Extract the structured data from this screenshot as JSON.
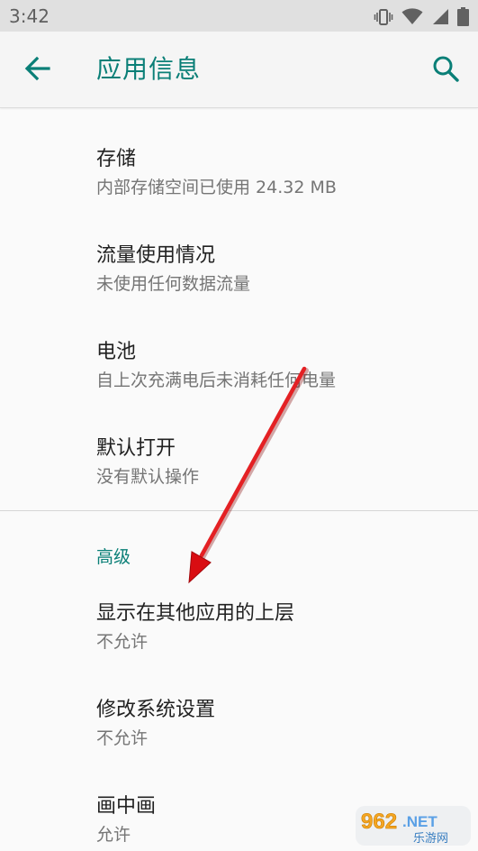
{
  "status_bar": {
    "time": "3:42",
    "icons": [
      "vibrate-icon",
      "wifi-icon",
      "signal-icon",
      "battery-icon"
    ]
  },
  "header": {
    "title": "应用信息",
    "back_icon": "back-arrow-icon",
    "search_icon": "search-icon"
  },
  "colors": {
    "accent": "#0a7f77",
    "background": "#fafafa",
    "status_bar_bg": "#e0e0e0",
    "annotation_arrow": "#e5141a"
  },
  "sections": {
    "main_items": [
      {
        "title": "存储",
        "summary": "内部存储空间已使用 24.32 MB"
      },
      {
        "title": "流量使用情况",
        "summary": "未使用任何数据流量"
      },
      {
        "title": "电池",
        "summary": "自上次充满电后未消耗任何电量"
      },
      {
        "title": "默认打开",
        "summary": "没有默认操作"
      }
    ],
    "advanced_header": "高级",
    "advanced_items": [
      {
        "title": "显示在其他应用的上层",
        "summary": "不允许"
      },
      {
        "title": "修改系统设置",
        "summary": "不允许"
      },
      {
        "title": "画中画",
        "summary": "允许"
      }
    ]
  },
  "watermark": {
    "text_main": "962",
    "text_suffix": ".NET",
    "text_sub": "乐游网"
  }
}
